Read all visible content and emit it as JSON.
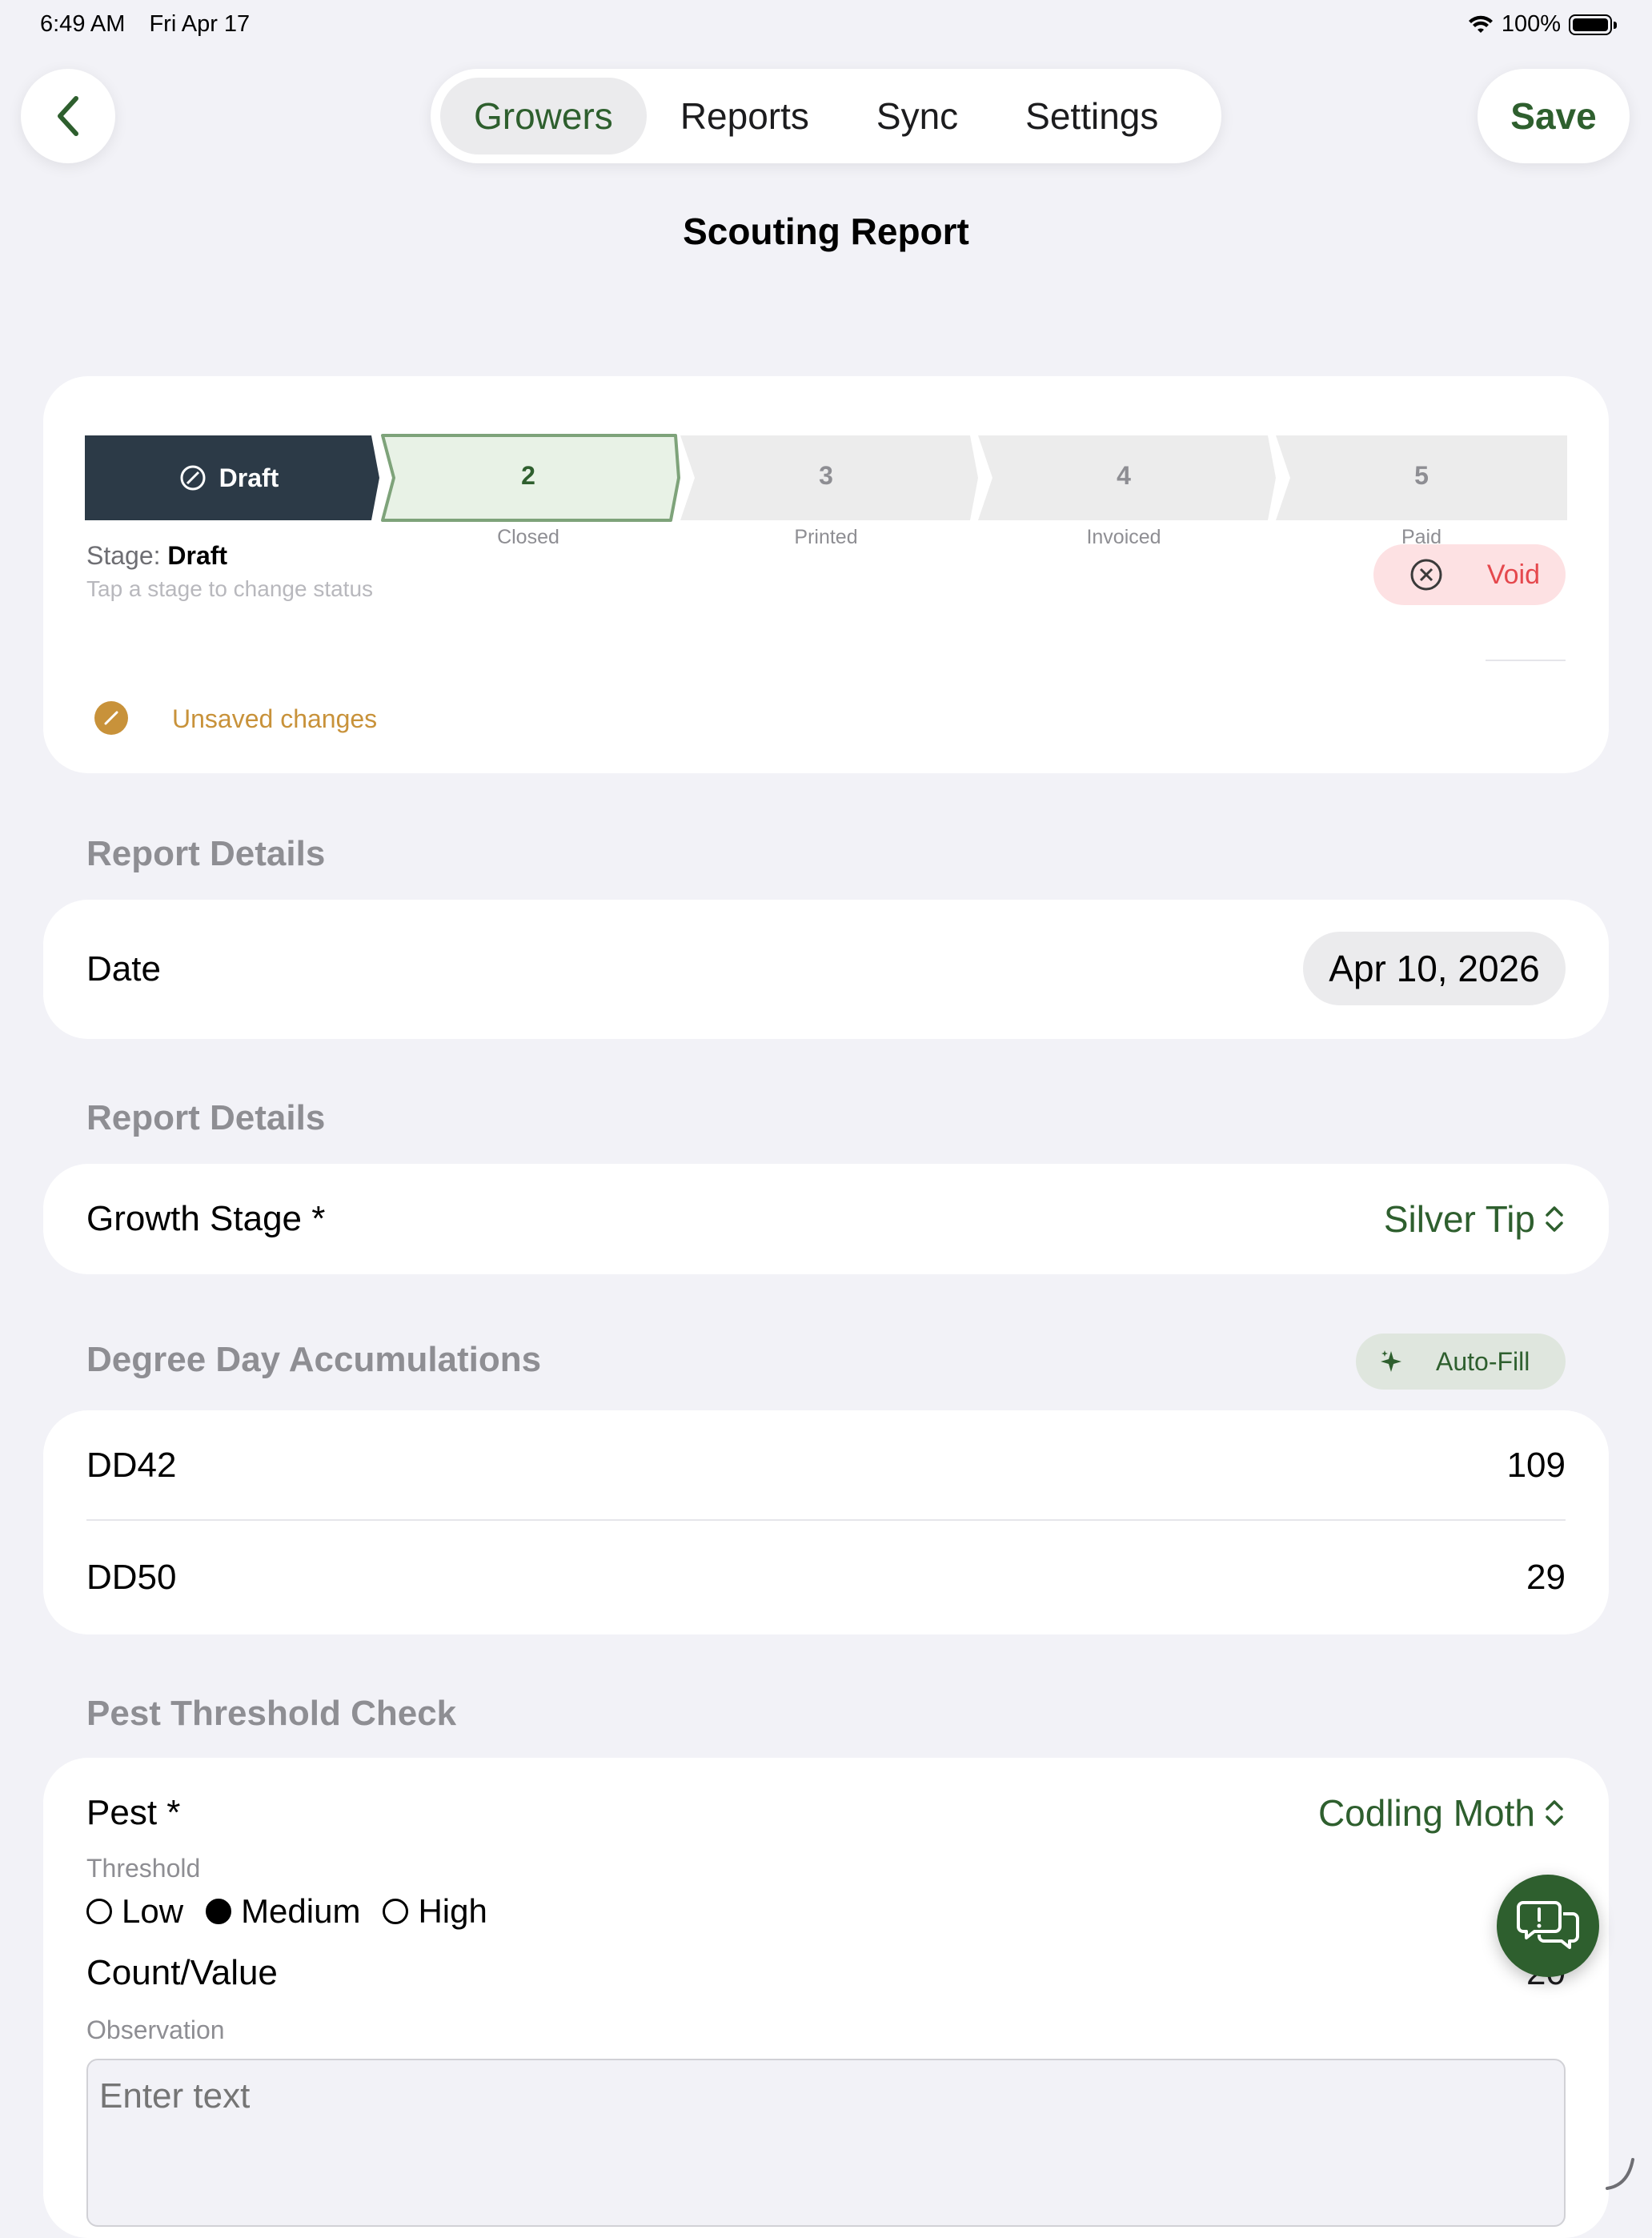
{
  "status_bar": {
    "time": "6:49 AM",
    "date": "Fri Apr 17",
    "battery": "100%"
  },
  "nav": {
    "back_icon": "chevron-left-icon",
    "tabs": [
      {
        "label": "Growers",
        "active": true
      },
      {
        "label": "Reports",
        "active": false
      },
      {
        "label": "Sync",
        "active": false
      },
      {
        "label": "Settings",
        "active": false
      }
    ],
    "save_label": "Save"
  },
  "page_title": "Scouting Report",
  "stepper": {
    "stages": [
      {
        "number": "",
        "title": "Draft",
        "caption": "",
        "state": "current"
      },
      {
        "number": "2",
        "title": "",
        "caption": "Closed",
        "state": "next"
      },
      {
        "number": "3",
        "title": "",
        "caption": "Printed",
        "state": "future"
      },
      {
        "number": "4",
        "title": "",
        "caption": "Invoiced",
        "state": "future"
      },
      {
        "number": "5",
        "title": "",
        "caption": "Paid",
        "state": "future"
      }
    ],
    "stage_prefix": "Stage:",
    "stage_value": "Draft",
    "hint": "Tap a stage to change status",
    "void_label": "Void",
    "unsaved_label": "Unsaved changes"
  },
  "report_details": {
    "title": "Report Details",
    "date_label": "Date",
    "date_value": "Apr 10, 2026"
  },
  "growth": {
    "title": "Report Details",
    "label": "Growth Stage *",
    "value": "Silver Tip"
  },
  "degree_days": {
    "title": "Degree Day Accumulations",
    "autofill_label": "Auto-Fill",
    "rows": [
      {
        "label": "DD42",
        "value": "109"
      },
      {
        "label": "DD50",
        "value": "29"
      }
    ]
  },
  "pest": {
    "title": "Pest Threshold Check",
    "pest_label": "Pest *",
    "pest_value": "Codling Moth",
    "threshold_label": "Threshold",
    "threshold_options": [
      {
        "label": "Low",
        "selected": false
      },
      {
        "label": "Medium",
        "selected": true
      },
      {
        "label": "High",
        "selected": false
      }
    ],
    "count_label": "Count/Value",
    "count_value": "20",
    "observation_label": "Observation",
    "observation_placeholder": "Enter text"
  },
  "colors": {
    "accent_green": "#2e5f2e",
    "dark_stage": "#2c3a47",
    "void_red": "#e5484d",
    "unsaved_orange": "#c8923a"
  }
}
